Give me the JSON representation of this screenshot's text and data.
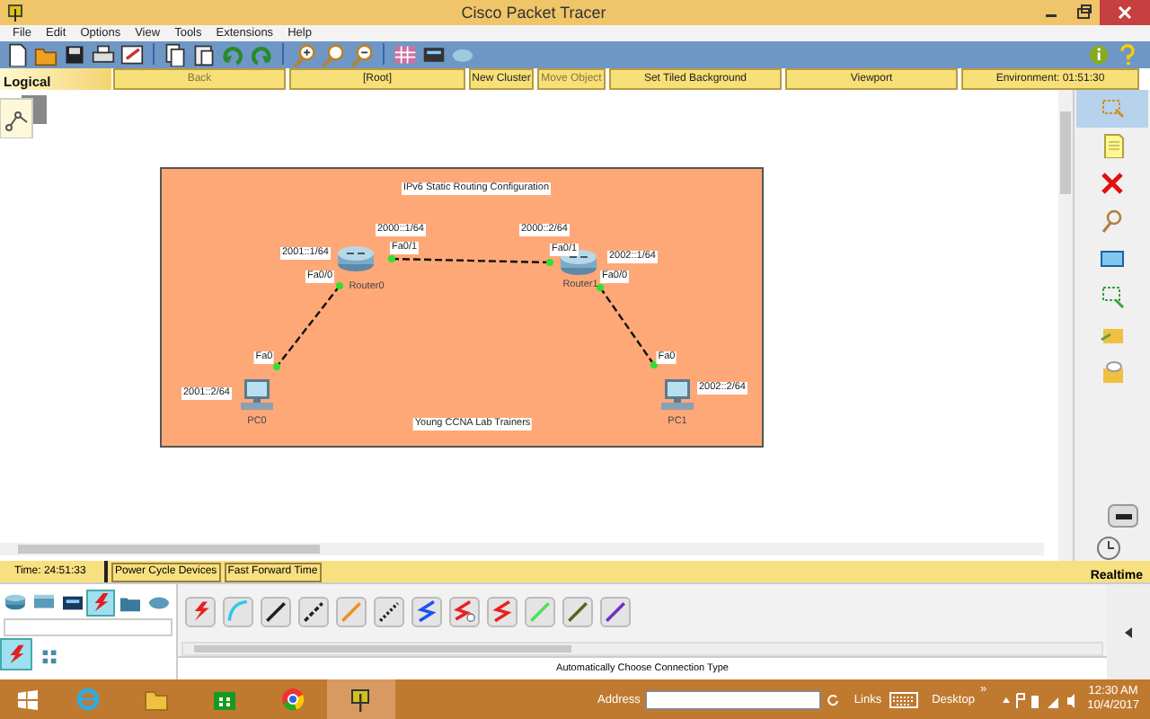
{
  "window": {
    "title": "Cisco Packet Tracer"
  },
  "menu": [
    "File",
    "Edit",
    "Options",
    "View",
    "Tools",
    "Extensions",
    "Help"
  ],
  "nav_bar": {
    "tab": "Logical",
    "buttons": [
      {
        "label": "Back",
        "disabled": true
      },
      {
        "label": "[Root]",
        "disabled": false
      },
      {
        "label": "New Cluster",
        "disabled": false
      },
      {
        "label": "Move Object",
        "disabled": true
      },
      {
        "label": "Set Tiled Background",
        "disabled": false
      },
      {
        "label": "Viewport",
        "disabled": false
      },
      {
        "label": "Environment: 01:51:30",
        "disabled": false
      }
    ]
  },
  "workspace": {
    "cluster": {
      "title": "IPv6 Static Routing Configuration",
      "footer": "Young CCNA Lab Trainers"
    },
    "devices": [
      {
        "kind": "router",
        "name": "Router0",
        "addresses": [
          "2001::1/64",
          "2000::1/64"
        ],
        "ports": [
          "Fa0/0",
          "Fa0/1"
        ]
      },
      {
        "kind": "router",
        "name": "Router1",
        "addresses": [
          "2000::2/64",
          "2002::1/64"
        ],
        "ports": [
          "Fa0/1",
          "Fa0/0"
        ]
      },
      {
        "kind": "pc",
        "name": "PC0",
        "addresses": [
          "2001::2/64"
        ],
        "ports": [
          "Fa0"
        ]
      },
      {
        "kind": "pc",
        "name": "PC1",
        "addresses": [
          "2002::2/64"
        ],
        "ports": [
          "Fa0"
        ]
      }
    ],
    "links": [
      {
        "kind": "dashed"
      },
      {
        "kind": "dashed"
      },
      {
        "kind": "dashed"
      }
    ]
  },
  "tools": [
    {
      "kind": "select",
      "selected": true
    },
    {
      "kind": "note",
      "selected": false
    },
    {
      "kind": "delete",
      "selected": false
    },
    {
      "kind": "inspect",
      "selected": false
    },
    {
      "kind": "shape",
      "selected": false
    },
    {
      "kind": "resize",
      "selected": false
    },
    {
      "kind": "simple-pdu",
      "selected": false
    },
    {
      "kind": "complex-pdu",
      "selected": false
    }
  ],
  "time_bar": {
    "time": "Time: 24:51:33",
    "buttons": [
      "Power Cycle Devices",
      "Fast Forward Time"
    ],
    "mode": "Realtime"
  },
  "device_box": {
    "categories": [
      {
        "kind": "router",
        "selected": false
      },
      {
        "kind": "switch",
        "selected": false
      },
      {
        "kind": "hub",
        "selected": false
      },
      {
        "kind": "connection",
        "selected": true
      },
      {
        "kind": "end-device",
        "selected": false
      },
      {
        "kind": "cloud",
        "selected": false
      }
    ],
    "subcategories": [
      {
        "kind": "connection",
        "selected": true
      },
      {
        "kind": "grid",
        "selected": false
      }
    ],
    "connections": [
      {
        "kind": "bolt",
        "color": "#e82020"
      },
      {
        "kind": "curve",
        "color": "#30c8e8"
      },
      {
        "kind": "line",
        "color": "#202020"
      },
      {
        "kind": "dashed",
        "color": "#202020"
      },
      {
        "kind": "line",
        "color": "#f09020"
      },
      {
        "kind": "dotted",
        "color": "#202020"
      },
      {
        "kind": "zigzag",
        "color": "#2050f0"
      },
      {
        "kind": "zigzag-clock",
        "color": "#e82020"
      },
      {
        "kind": "zigzag",
        "color": "#e82020"
      },
      {
        "kind": "line",
        "color": "#50e050"
      },
      {
        "kind": "line",
        "color": "#606020"
      },
      {
        "kind": "line",
        "color": "#7030c0"
      }
    ],
    "status": "Automatically Choose Connection Type"
  },
  "taskbar": {
    "apps": [
      {
        "kind": "ie",
        "selected": false
      },
      {
        "kind": "explorer",
        "selected": false
      },
      {
        "kind": "store",
        "selected": false
      },
      {
        "kind": "chrome",
        "selected": false
      },
      {
        "kind": "packet-tracer",
        "selected": true
      }
    ],
    "address_label": "Address",
    "links": "Links",
    "desktop": "Desktop",
    "more": "»",
    "time": "12:30 AM",
    "date": "10/4/2017"
  }
}
